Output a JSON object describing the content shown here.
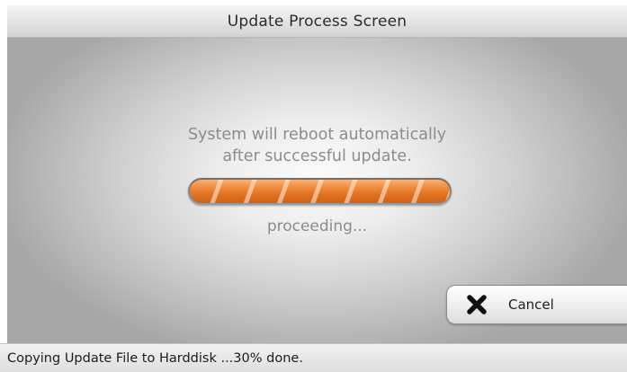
{
  "window": {
    "title": "Update Process Screen"
  },
  "main": {
    "message_line1": "System will reboot automatically",
    "message_line2": "after successful update.",
    "status_word": "proceeding...",
    "progress": {
      "style": "indeterminate-striped",
      "fill_color": "#e87a2a"
    }
  },
  "cancel_button": {
    "label": "Cancel",
    "icon": "close-x-icon"
  },
  "status_bar": {
    "text": "Copying Update File to Harddisk ...30% done.",
    "percent_done": 30
  },
  "colors": {
    "accent_orange": "#e87a2a",
    "message_gray": "#8c8c8c"
  }
}
